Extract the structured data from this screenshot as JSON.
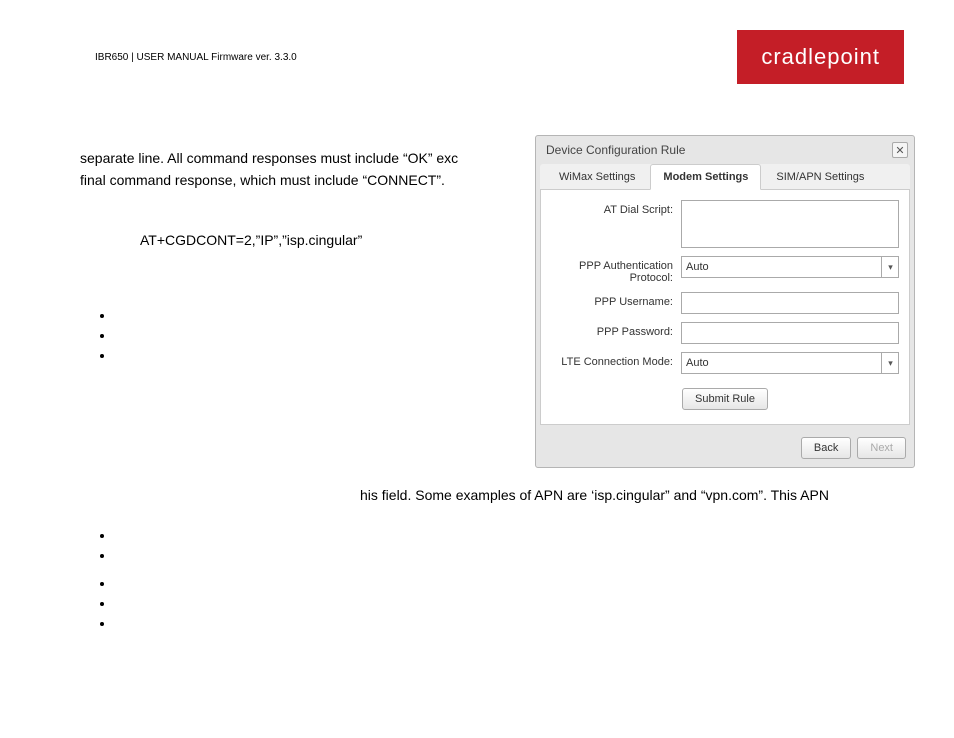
{
  "header": {
    "product_line": "IBR650 | USER MANUAL Firmware ver. 3.3.0",
    "brand": "cradlepoint"
  },
  "body": {
    "line1": "separate line. All command responses must include “OK” exc",
    "line2": "final command response, which must include “CONNECT”.",
    "code": "AT+CGDCONT=2,”IP”,”isp.cingular”",
    "line3": "his field. Some examples of APN are ‘isp.cingular” and “vpn.com”. This APN"
  },
  "dialog": {
    "title": "Device Configuration Rule",
    "tabs": {
      "wimax": "WiMax Settings",
      "modem": "Modem Settings",
      "sim": "SIM/APN Settings"
    },
    "form": {
      "at_dial_label": "AT Dial Script:",
      "at_dial_value": "",
      "ppp_auth_label": "PPP Authentication Protocol:",
      "ppp_auth_value": "Auto",
      "ppp_user_label": "PPP Username:",
      "ppp_user_value": "",
      "ppp_pass_label": "PPP Password:",
      "ppp_pass_value": "",
      "lte_mode_label": "LTE Connection Mode:",
      "lte_mode_value": "Auto",
      "submit_label": "Submit Rule"
    },
    "footer": {
      "back": "Back",
      "next": "Next"
    }
  }
}
